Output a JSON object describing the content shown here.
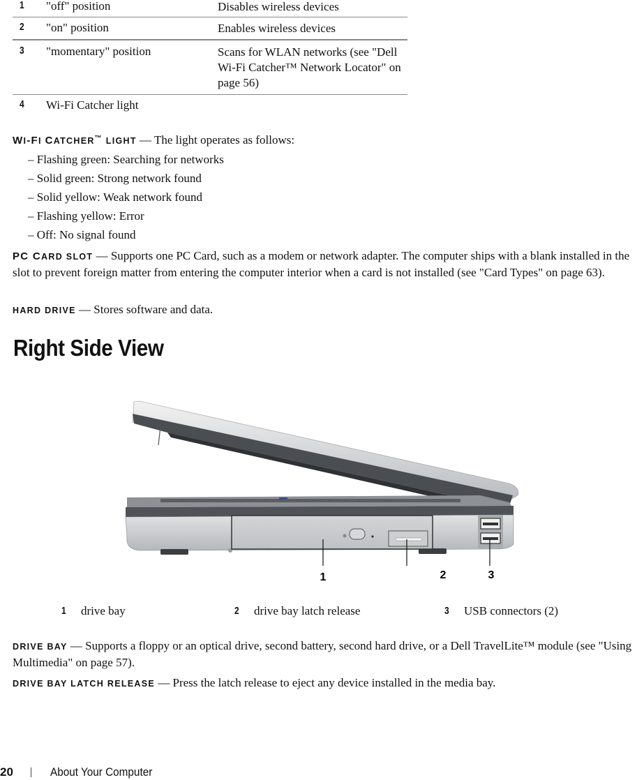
{
  "spec_table": {
    "rows": [
      {
        "num": "1",
        "name": "\"off\" position",
        "desc": "Disables wireless devices"
      },
      {
        "num": "2",
        "name": "\"on\" position",
        "desc": "Enables wireless devices"
      },
      {
        "num": "3",
        "name": "\"momentary\" position",
        "desc": "Scans for WLAN networks (see \"Dell Wi-Fi Catcher™ Network Locator\" on page 56)"
      },
      {
        "num": "4",
        "name": "Wi-Fi Catcher light",
        "desc": ""
      }
    ]
  },
  "wifi_catcher": {
    "term_w": "W",
    "term_i": "I",
    "term_dash_f": "-F",
    "term_i2": "I ",
    "term_c": "C",
    "term_atcher": "ATCHER",
    "term_tm": "™",
    "term_light": " LIGHT",
    "dash": " — ",
    "text": "The light operates as follows:",
    "states": [
      "– Flashing green: Searching for networks",
      "– Solid green: Strong network found",
      "– Solid yellow: Weak network found",
      "– Flashing yellow: Error",
      "– Off: No signal found"
    ]
  },
  "pc_card_slot": {
    "term_pc": "PC C",
    "term_rest": "ARD SLOT",
    "dash": " — ",
    "text": "Supports one PC Card, such as a modem or network adapter. The computer ships with a blank installed in the slot to prevent foreign matter from entering the computer interior when a card is not installed (see \"Card Types\" on page 63)."
  },
  "hard_drive": {
    "term": "HARD DRIVE",
    "dash": " — ",
    "text": "Stores software and data."
  },
  "section_heading": "Right Side View",
  "figure": {
    "alt": "Right side view of laptop",
    "callouts": [
      "1",
      "2",
      "3"
    ]
  },
  "legend": [
    {
      "num": "1",
      "label": "drive bay"
    },
    {
      "num": "2",
      "label": "drive bay latch release"
    },
    {
      "num": "3",
      "label": "USB connectors (2)"
    }
  ],
  "drive_bay": {
    "term": "DRIVE BAY",
    "dash": " — ",
    "text": "Supports a floppy or an optical drive, second battery, second hard drive, or a Dell TravelLite™ module (see \"Using Multimedia\" on page 57)."
  },
  "drive_bay_latch": {
    "term": "DRIVE BAY LATCH RELEASE",
    "dash": " — ",
    "text": "Press the latch release to eject any device installed in the media bay."
  },
  "footer": {
    "page_number": "20",
    "chapter_title": "About Your Computer"
  }
}
